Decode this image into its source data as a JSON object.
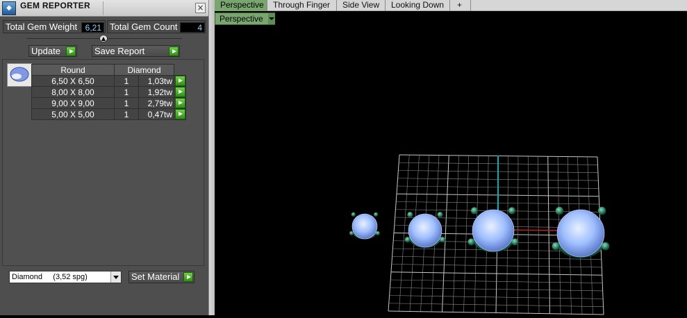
{
  "panel": {
    "title": "GEM REPORTER",
    "close_label": "×",
    "total_weight_label": "Total Gem Weight",
    "total_weight_value": "6,21",
    "total_count_label": "Total Gem Count",
    "total_count_value": "4",
    "update_label": "Update",
    "save_report_label": "Save Report",
    "table": {
      "headers": [
        "Round",
        "Diamond"
      ],
      "rows": [
        {
          "size": "6,50 X 6,50",
          "qty": "1",
          "weight": "1,03tw"
        },
        {
          "size": "8,00 X 8,00",
          "qty": "1",
          "weight": "1,92tw"
        },
        {
          "size": "9,00 X 9,00",
          "qty": "1",
          "weight": "2,79tw"
        },
        {
          "size": "5,00 X 5,00",
          "qty": "1",
          "weight": "0,47tw"
        }
      ]
    },
    "material_select_value": "Diamond     (3,52 spg)",
    "set_material_label": "Set Material"
  },
  "tabs": [
    {
      "label": "Perspective",
      "active": true
    },
    {
      "label": "Through Finger",
      "active": false
    },
    {
      "label": "Side View",
      "active": false
    },
    {
      "label": "Looking Down",
      "active": false
    },
    {
      "label": "+",
      "active": false
    }
  ],
  "viewport": {
    "view_dropdown_label": "Perspective"
  },
  "icons": {
    "app": "gem-reporter-icon",
    "add_tab": "plus-icon",
    "action": "green-arrow-icon"
  },
  "colors": {
    "accent_green": "#79a66f",
    "button_green": "#3fae20",
    "value_text": "#8fd3ff",
    "grid": "#a8a8a8",
    "gem": "#a9c8ff",
    "prong": "#1e7a5a"
  }
}
